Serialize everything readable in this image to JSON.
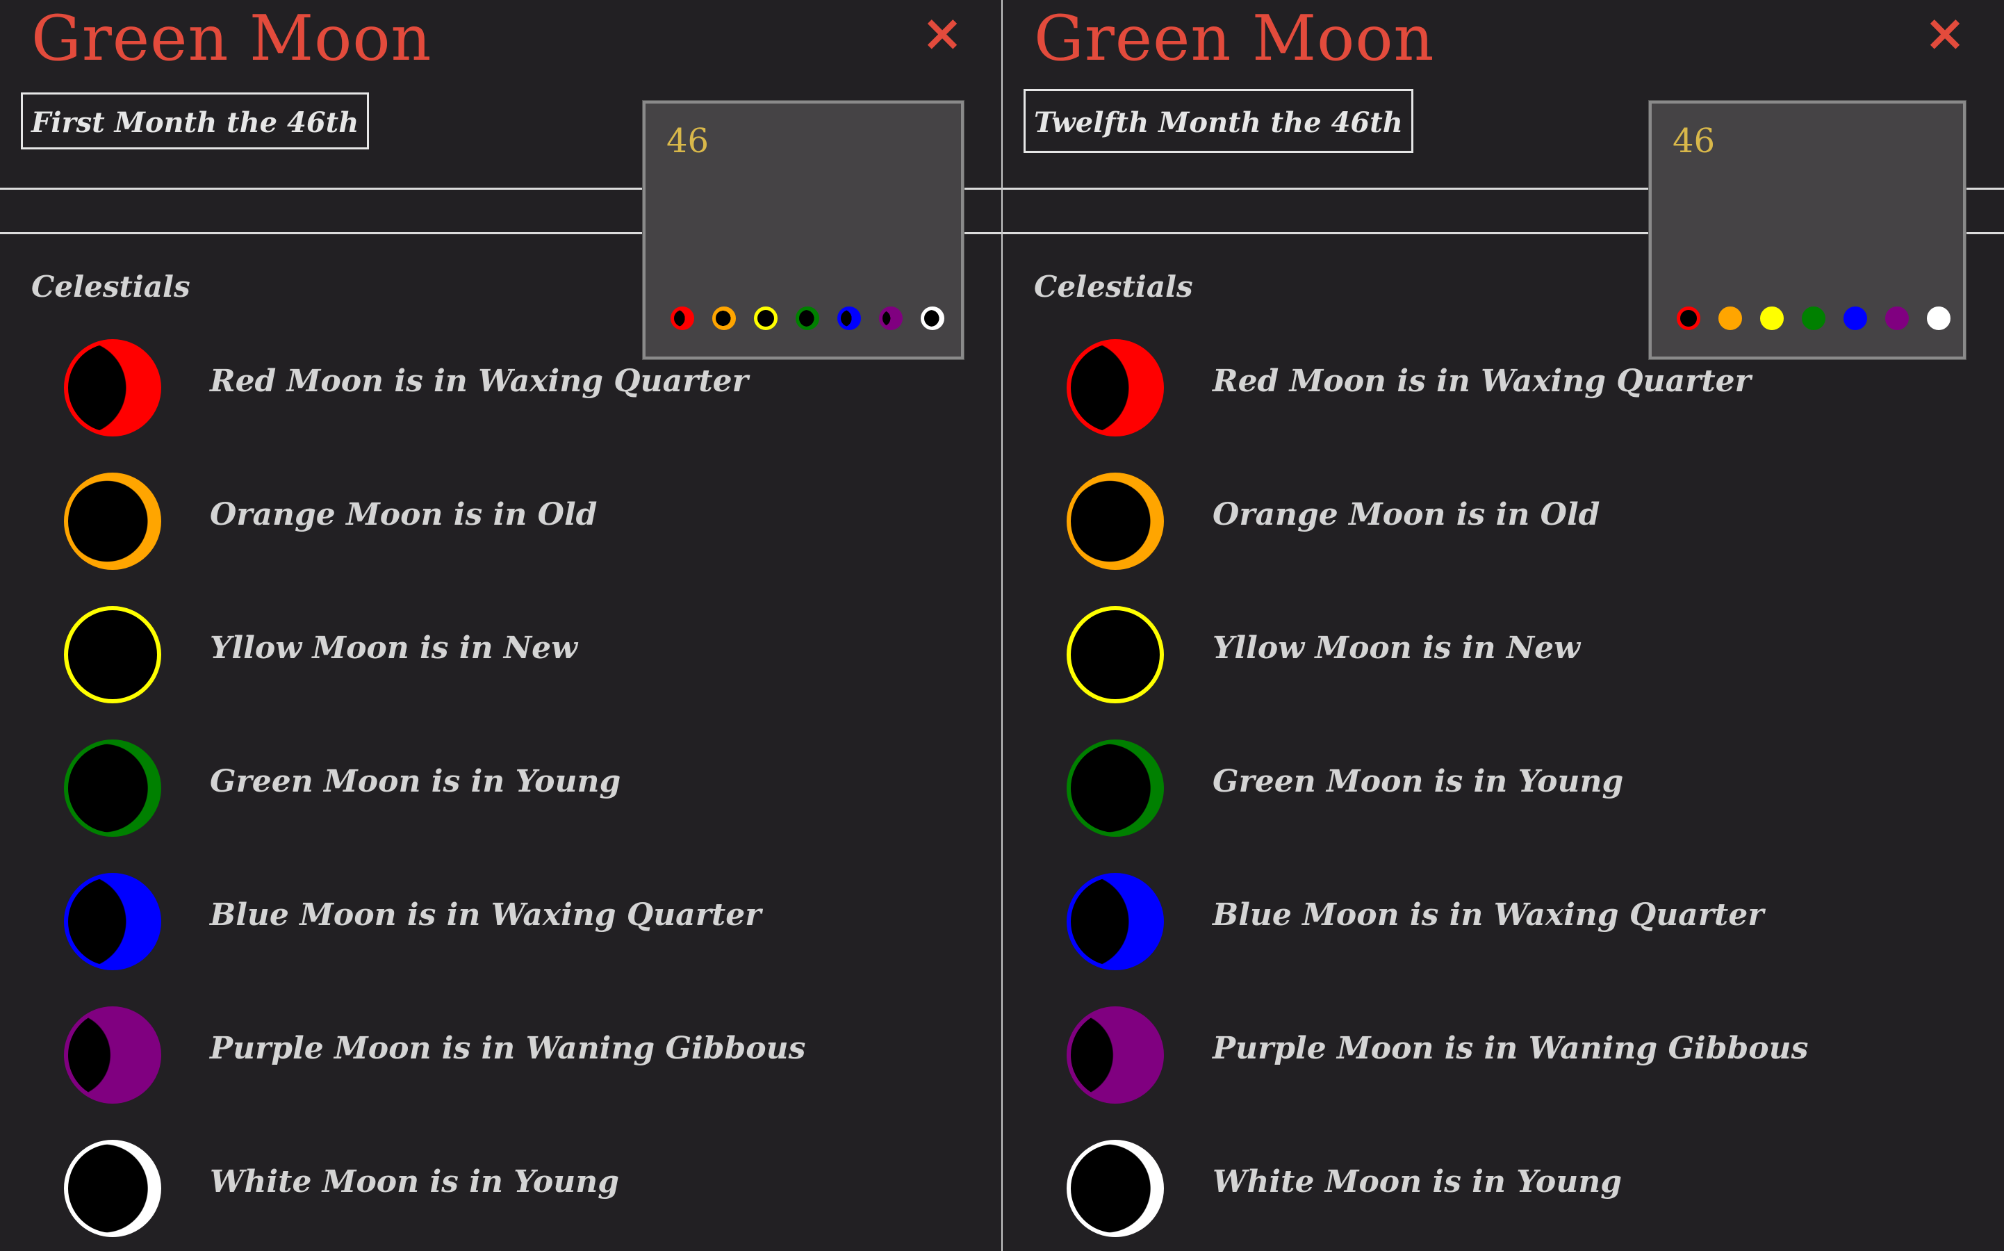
{
  "panels": [
    {
      "title": "Green Moon",
      "close_icon": "×",
      "date": "First Month the 46th",
      "section": "Celestials",
      "day_number": "46",
      "dots": [
        {
          "color": "#ff0000",
          "phase": "waxing-quarter"
        },
        {
          "color": "#ffa500",
          "phase": "old"
        },
        {
          "color": "#ffff00",
          "phase": "new"
        },
        {
          "color": "#008000",
          "phase": "young"
        },
        {
          "color": "#0000ff",
          "phase": "waxing-quarter"
        },
        {
          "color": "#800080",
          "phase": "waning-gibbous"
        },
        {
          "color": "#ffffff",
          "phase": "young"
        }
      ],
      "moons": [
        {
          "label": "Red Moon is in Waxing Quarter",
          "color": "#ff0000",
          "phase": "waxing-quarter"
        },
        {
          "label": "Orange Moon is in Old",
          "color": "#ffa500",
          "phase": "old"
        },
        {
          "label": "Yllow Moon is in New",
          "color": "#ffff00",
          "phase": "new"
        },
        {
          "label": "Green Moon is in Young",
          "color": "#008000",
          "phase": "young"
        },
        {
          "label": "Blue Moon is in Waxing Quarter",
          "color": "#0000ff",
          "phase": "waxing-quarter"
        },
        {
          "label": "Purple Moon is in Waning Gibbous",
          "color": "#800080",
          "phase": "waning-gibbous"
        },
        {
          "label": "White Moon is in Young",
          "color": "#ffffff",
          "phase": "young"
        }
      ]
    },
    {
      "title": "Green Moon",
      "close_icon": "×",
      "date": "Twelfth Month the 46th",
      "section": "Celestials",
      "day_number": "46",
      "dots": [
        {
          "color": "#ff0000",
          "phase": "new"
        },
        {
          "color": "#ffa500",
          "phase": "full"
        },
        {
          "color": "#ffff00",
          "phase": "full"
        },
        {
          "color": "#008000",
          "phase": "full"
        },
        {
          "color": "#0000ff",
          "phase": "full"
        },
        {
          "color": "#800080",
          "phase": "full"
        },
        {
          "color": "#ffffff",
          "phase": "full"
        }
      ],
      "moons": [
        {
          "label": "Red Moon is in Waxing Quarter",
          "color": "#ff0000",
          "phase": "waxing-quarter"
        },
        {
          "label": "Orange Moon is in Old",
          "color": "#ffa500",
          "phase": "old"
        },
        {
          "label": "Yllow Moon is in New",
          "color": "#ffff00",
          "phase": "new"
        },
        {
          "label": "Green Moon is in Young",
          "color": "#008000",
          "phase": "young"
        },
        {
          "label": "Blue Moon is in Waxing Quarter",
          "color": "#0000ff",
          "phase": "waxing-quarter"
        },
        {
          "label": "Purple Moon is in Waning Gibbous",
          "color": "#800080",
          "phase": "waning-gibbous"
        },
        {
          "label": "White Moon is in Young",
          "color": "#ffffff",
          "phase": "young"
        }
      ]
    }
  ]
}
